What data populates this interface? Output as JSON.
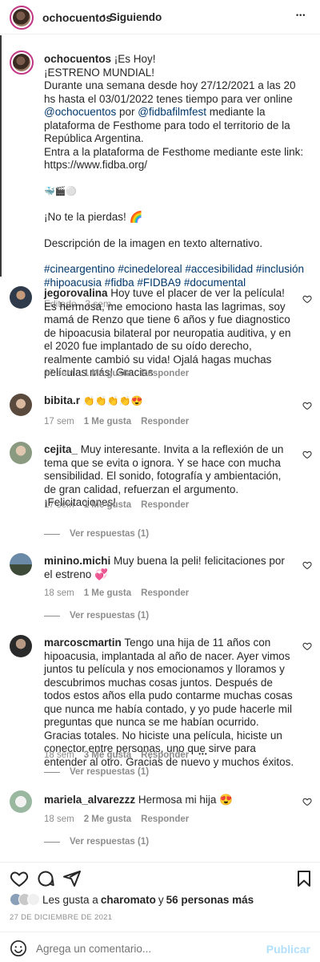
{
  "header": {
    "username": "ochocuentos",
    "separator": "•",
    "follow_status": "Siguiendo",
    "more": "•••"
  },
  "caption": {
    "username": "ochocuentos",
    "line1": "¡Es Hoy!",
    "line2": "¡ESTRENO MUNDIAL!",
    "para1_a": "Durante una semana desde hoy 27/12/2021 a las 20 hs hasta el 03/01/2022 tenes tiempo para ver online ",
    "mention1": "@ochocuentos",
    "para1_b": " por ",
    "mention2": "@fidbafilmfest",
    "para1_c": " mediante la plataforma de Festhome para todo el territorio de la República Argentina.",
    "para2": "Entra a la plataforma de Festhome mediante este link:",
    "url": "https://www.fidba.org/",
    "emoji_line": "🐳🎬⚪",
    "no_te": "¡No te la pierdas! 🌈",
    "alt_text": "Descripción de la imagen en texto alternativo.",
    "hashtags1": "#cineargentino #cinedeloreal #accesibilidad #inclusión",
    "hashtags2": "#hipoacusia #fidba #FIDBA9 #documental",
    "edited": "Editado · 3 sem"
  },
  "comments": [
    {
      "username": "jegorovalina",
      "text": "Hoy tuve el placer de ver la película! Es hermosa, me emociono hasta las lagrimas, soy mamá de Renzo que tiene 6 años y fue diagnostico de hipoacusia bilateral por neuropatia auditiva, y en el 2020 fue implantado de su oído derecho, realmente cambió su vida! Ojalá hagas muchas películas más! Gracias",
      "time": "17 sem",
      "likes": "1 Me gusta",
      "reply": "Responder"
    },
    {
      "username": "bibita.r",
      "text": "👏👏👏👏😍",
      "time": "17 sem",
      "likes": "1 Me gusta",
      "reply": "Responder"
    },
    {
      "username": "cejita_",
      "text": "Muy interesante. Invita a la reflexión de un tema que se evita o ignora. Y se hace con mucha sensibilidad. El sonido, fotografía y ambientación, de gran calidad, refuerzan el argumento. ¡Felicitaciones!",
      "time": "17 sem",
      "likes": "1 Me gusta",
      "reply": "Responder",
      "view_replies": "Ver respuestas (1)"
    },
    {
      "username": "minino.michi",
      "text": "Muy buena la peli! felicitaciones por el estreno 💞",
      "time": "18 sem",
      "likes": "1 Me gusta",
      "reply": "Responder",
      "view_replies": "Ver respuestas (1)"
    },
    {
      "username": "marcoscmartin",
      "text": "Tengo una hija de 11 años con hipoacusia, implantada al año de nacer. Ayer vimos juntos tu película y nos emocionamos y lloramos y descubrimos muchas cosas juntos. Después de todos estos años ella pudo contarme muchas cosas que nunca me había contado, y yo pude hacerle mil preguntas que nunca se me habían ocurrido. Gracias totales. No hiciste una película, hiciste un conector entre personas, uno que sirve para entender al otro. Gracias de nuevo y muchos éxitos.",
      "time": "18 sem",
      "likes": "3 Me gusta",
      "reply": "Responder",
      "more": "•••",
      "view_replies": "Ver respuestas (1)"
    },
    {
      "username": "mariela_alvarezzz",
      "text": "Hermosa mi hija 😍",
      "time": "18 sem",
      "likes": "2 Me gusta",
      "reply": "Responder",
      "view_replies": "Ver respuestas (1)"
    }
  ],
  "likes_summary": {
    "prefix": "Les gusta a ",
    "user": "charomato",
    "middle": " y ",
    "others": "56 personas más"
  },
  "date": "27 DE DICIEMBRE DE 2021",
  "add_comment": {
    "placeholder": "Agrega un comentario...",
    "publish": "Publicar"
  },
  "colors": {
    "text": "#262626",
    "muted": "#8e8e8e",
    "link": "#00376b",
    "publish_disabled": "#b2dffc"
  }
}
